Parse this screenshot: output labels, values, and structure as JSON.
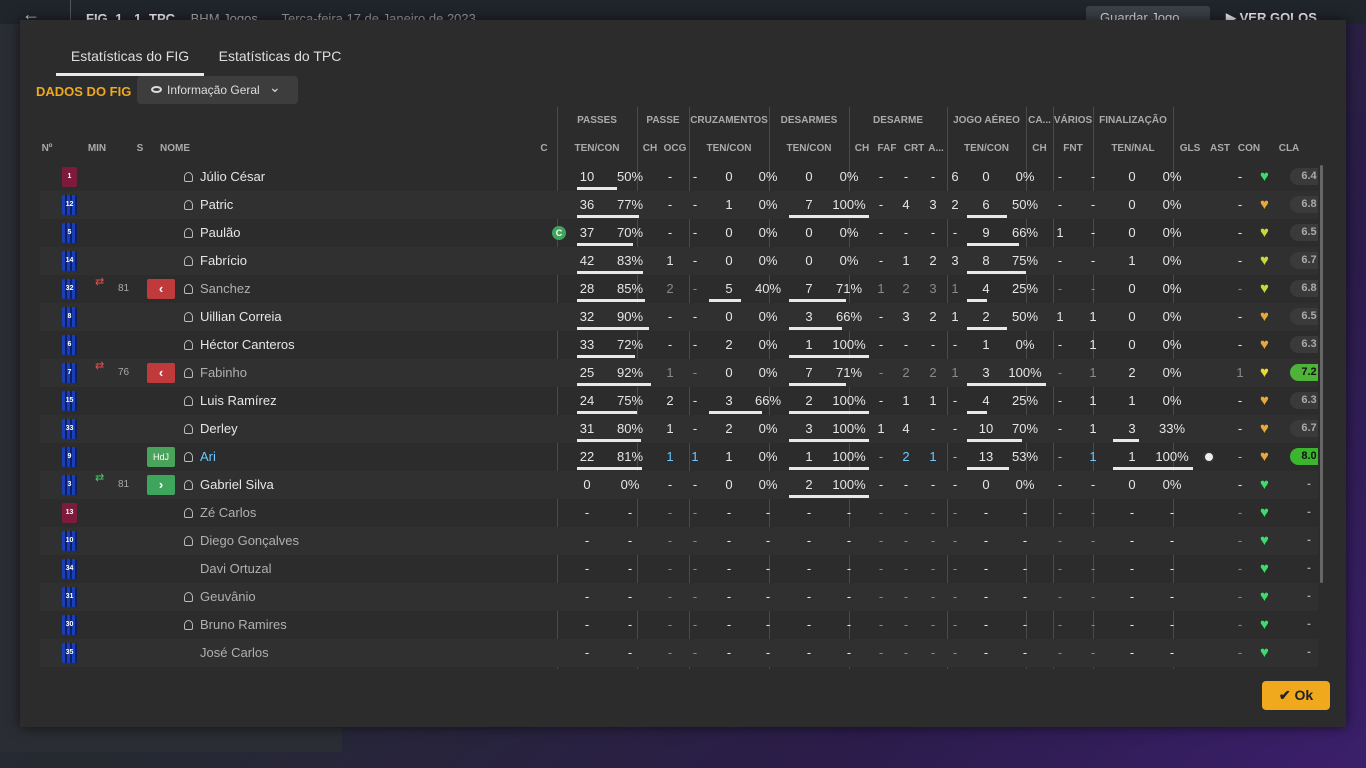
{
  "topbar": {
    "home": "FIG",
    "score_home": "1",
    "score_away": "1",
    "away": "TPC",
    "competition": "BHM Jogos",
    "date": "Terça-feira 17 de Janeiro de 2023",
    "save_label": "Guardar Jogo",
    "goals_label": "VER GOLOS"
  },
  "tabs": [
    "Estatísticas do FIG",
    "Estatísticas do TPC"
  ],
  "section_title": "DADOS DO FIG",
  "view_dropdown": "Informação Geral",
  "group_headers": {
    "passes": "PASSES",
    "passe": "PASSE",
    "cruzamentos": "CRUZAMENTOS",
    "desarmes": "DESARMES",
    "desarme": "DESARME",
    "jogo_aereo": "JOGO AÉREO",
    "ca": "CA...",
    "varios": "VÁRIOS",
    "finalizacao": "FINALIZAÇÃO"
  },
  "columns": {
    "no": "Nº",
    "min": "MIN",
    "s": "S",
    "nome": "NOME",
    "c": "C",
    "passes_tc": "TEN/CON",
    "passe_ch": "CH",
    "passe_ocg": "OCG",
    "cruz_tc": "TEN/CON",
    "des_tc": "TEN/CON",
    "desa_ch": "CH",
    "desa_faf": "FAF",
    "desa_crt": "CRT",
    "desa_a": "A...",
    "aereo_tc": "TEN/CON",
    "ca_ch": "CH",
    "var_fnt": "FNT",
    "fin_tn": "TEN/NAL",
    "gls": "GLS",
    "ast": "AST",
    "con": "CON",
    "cla": "CLA"
  },
  "players": [
    {
      "no": "1",
      "shirt": "gk",
      "min": "",
      "sub": "",
      "name": "Júlio César",
      "cap": false,
      "dim": false,
      "hl": false,
      "pas": "10",
      "pasp": "50%",
      "pch": "-",
      "ocg": "-",
      "cru": "0",
      "crup": "0%",
      "des": "0",
      "desp": "0%",
      "dch": "-",
      "faf": "-",
      "crt": "-",
      "da": "6",
      "aer": "0",
      "aerp": "0%",
      "cach": "-",
      "fnt": "-",
      "fin": "0",
      "finp": "0%",
      "gls": "",
      "ast": "-",
      "con": "#3ddc6a",
      "cla": "6.4",
      "rate": ""
    },
    {
      "no": "12",
      "shirt": "blue",
      "min": "",
      "sub": "",
      "name": "Patric",
      "cap": false,
      "dim": false,
      "hl": false,
      "pas": "36",
      "pasp": "77%",
      "pch": "-",
      "ocg": "-",
      "cru": "1",
      "crup": "0%",
      "des": "7",
      "desp": "100%",
      "dch": "-",
      "faf": "4",
      "crt": "3",
      "da": "2",
      "aer": "6",
      "aerp": "50%",
      "cach": "-",
      "fnt": "-",
      "fin": "0",
      "finp": "0%",
      "gls": "",
      "ast": "-",
      "con": "#e8a83a",
      "cla": "6.8",
      "rate": ""
    },
    {
      "no": "5",
      "shirt": "blue",
      "min": "",
      "sub": "",
      "name": "Paulão",
      "cap": true,
      "dim": false,
      "hl": false,
      "pas": "37",
      "pasp": "70%",
      "pch": "-",
      "ocg": "-",
      "cru": "0",
      "crup": "0%",
      "des": "0",
      "desp": "0%",
      "dch": "-",
      "faf": "-",
      "crt": "-",
      "da": "-",
      "aer": "9",
      "aerp": "66%",
      "cach": "1",
      "fnt": "-",
      "fin": "0",
      "finp": "0%",
      "gls": "",
      "ast": "-",
      "con": "#c8d83a",
      "cla": "6.5",
      "rate": ""
    },
    {
      "no": "14",
      "shirt": "blue",
      "min": "",
      "sub": "",
      "name": "Fabrício",
      "cap": false,
      "dim": false,
      "hl": false,
      "pas": "42",
      "pasp": "83%",
      "pch": "1",
      "ocg": "-",
      "cru": "0",
      "crup": "0%",
      "des": "0",
      "desp": "0%",
      "dch": "-",
      "faf": "1",
      "crt": "2",
      "da": "3",
      "aer": "8",
      "aerp": "75%",
      "cach": "-",
      "fnt": "-",
      "fin": "1",
      "finp": "0%",
      "gls": "",
      "ast": "-",
      "con": "#c8d83a",
      "cla": "6.7",
      "rate": ""
    },
    {
      "no": "32",
      "shirt": "blue",
      "min": "81",
      "sub": "out",
      "name": "Sanchez",
      "cap": false,
      "dim": true,
      "hl": false,
      "pas": "28",
      "pasp": "85%",
      "pch": "2",
      "ocg": "-",
      "cru": "5",
      "crup": "40%",
      "des": "7",
      "desp": "71%",
      "dch": "1",
      "faf": "2",
      "crt": "3",
      "da": "1",
      "aer": "4",
      "aerp": "25%",
      "cach": "-",
      "fnt": "-",
      "fin": "0",
      "finp": "0%",
      "gls": "",
      "ast": "-",
      "con": "#c8d83a",
      "cla": "6.8",
      "rate": ""
    },
    {
      "no": "8",
      "shirt": "blue",
      "min": "",
      "sub": "",
      "name": "Uillian Correia",
      "cap": false,
      "dim": false,
      "hl": false,
      "pas": "32",
      "pasp": "90%",
      "pch": "-",
      "ocg": "-",
      "cru": "0",
      "crup": "0%",
      "des": "3",
      "desp": "66%",
      "dch": "-",
      "faf": "3",
      "crt": "2",
      "da": "1",
      "aer": "2",
      "aerp": "50%",
      "cach": "1",
      "fnt": "1",
      "fin": "0",
      "finp": "0%",
      "gls": "",
      "ast": "-",
      "con": "#e8a83a",
      "cla": "6.5",
      "rate": ""
    },
    {
      "no": "6",
      "shirt": "blue",
      "min": "",
      "sub": "",
      "name": "Héctor Canteros",
      "cap": false,
      "dim": false,
      "hl": false,
      "pas": "33",
      "pasp": "72%",
      "pch": "-",
      "ocg": "-",
      "cru": "2",
      "crup": "0%",
      "des": "1",
      "desp": "100%",
      "dch": "-",
      "faf": "-",
      "crt": "-",
      "da": "-",
      "aer": "1",
      "aerp": "0%",
      "cach": "-",
      "fnt": "1",
      "fin": "0",
      "finp": "0%",
      "gls": "",
      "ast": "-",
      "con": "#e8a83a",
      "cla": "6.3",
      "rate": ""
    },
    {
      "no": "7",
      "shirt": "blue",
      "min": "76",
      "sub": "out",
      "name": "Fabinho",
      "cap": false,
      "dim": true,
      "hl": false,
      "pas": "25",
      "pasp": "92%",
      "pch": "1",
      "ocg": "-",
      "cru": "0",
      "crup": "0%",
      "des": "7",
      "desp": "71%",
      "dch": "-",
      "faf": "2",
      "crt": "2",
      "da": "1",
      "aer": "3",
      "aerp": "100%",
      "cach": "-",
      "fnt": "1",
      "fin": "2",
      "finp": "0%",
      "gls": "",
      "ast": "1",
      "con": "#e8d83a",
      "cla": "7.2",
      "rate": "good"
    },
    {
      "no": "15",
      "shirt": "blue",
      "min": "",
      "sub": "",
      "name": "Luis Ramírez",
      "cap": false,
      "dim": false,
      "hl": false,
      "pas": "24",
      "pasp": "75%",
      "pch": "2",
      "ocg": "-",
      "cru": "3",
      "crup": "66%",
      "des": "2",
      "desp": "100%",
      "dch": "-",
      "faf": "1",
      "crt": "1",
      "da": "-",
      "aer": "4",
      "aerp": "25%",
      "cach": "-",
      "fnt": "1",
      "fin": "1",
      "finp": "0%",
      "gls": "",
      "ast": "-",
      "con": "#e8a83a",
      "cla": "6.3",
      "rate": ""
    },
    {
      "no": "33",
      "shirt": "blue",
      "min": "",
      "sub": "",
      "name": "Derley",
      "cap": false,
      "dim": false,
      "hl": false,
      "pas": "31",
      "pasp": "80%",
      "pch": "1",
      "ocg": "-",
      "cru": "2",
      "crup": "0%",
      "des": "3",
      "desp": "100%",
      "dch": "1",
      "faf": "4",
      "crt": "-",
      "da": "-",
      "aer": "10",
      "aerp": "70%",
      "cach": "-",
      "fnt": "1",
      "fin": "3",
      "finp": "33%",
      "gls": "",
      "ast": "-",
      "con": "#e8a83a",
      "cla": "6.7",
      "rate": ""
    },
    {
      "no": "9",
      "shirt": "blue",
      "min": "",
      "sub": "hdl",
      "name": "Ari",
      "cap": false,
      "dim": false,
      "hl": true,
      "pas": "22",
      "pasp": "81%",
      "pch": "1",
      "ocg": "1",
      "cru": "1",
      "crup": "0%",
      "des": "1",
      "desp": "100%",
      "dch": "-",
      "faf": "2",
      "crt": "1",
      "da": "-",
      "aer": "13",
      "aerp": "53%",
      "cach": "-",
      "fnt": "1",
      "fin": "1",
      "finp": "100%",
      "gls": "ball",
      "ast": "-",
      "con": "#e8a83a",
      "cla": "8.0",
      "rate": "great"
    },
    {
      "no": "3",
      "shirt": "blue",
      "min": "81",
      "sub": "in",
      "name": "Gabriel Silva",
      "cap": false,
      "dim": false,
      "hl": false,
      "pas": "0",
      "pasp": "0%",
      "pch": "-",
      "ocg": "-",
      "cru": "0",
      "crup": "0%",
      "des": "2",
      "desp": "100%",
      "dch": "-",
      "faf": "-",
      "crt": "-",
      "da": "-",
      "aer": "0",
      "aerp": "0%",
      "cach": "-",
      "fnt": "-",
      "fin": "0",
      "finp": "0%",
      "gls": "",
      "ast": "-",
      "con": "#3ddc6a",
      "cla": "-",
      "rate": ""
    },
    {
      "no": "13",
      "shirt": "gk",
      "min": "",
      "sub": "",
      "name": "Zé Carlos",
      "cap": false,
      "dim": true,
      "hl": false,
      "pas": "-",
      "pasp": "-",
      "pch": "-",
      "ocg": "-",
      "cru": "-",
      "crup": "-",
      "des": "-",
      "desp": "-",
      "dch": "-",
      "faf": "-",
      "crt": "-",
      "da": "-",
      "aer": "-",
      "aerp": "-",
      "cach": "-",
      "fnt": "-",
      "fin": "-",
      "finp": "-",
      "gls": "",
      "ast": "-",
      "con": "#3ddc6a",
      "cla": "-",
      "rate": ""
    },
    {
      "no": "10",
      "shirt": "blue",
      "min": "",
      "sub": "",
      "name": "Diego Gonçalves",
      "cap": false,
      "dim": true,
      "hl": false,
      "pas": "-",
      "pasp": "-",
      "pch": "-",
      "ocg": "-",
      "cru": "-",
      "crup": "-",
      "des": "-",
      "desp": "-",
      "dch": "-",
      "faf": "-",
      "crt": "-",
      "da": "-",
      "aer": "-",
      "aerp": "-",
      "cach": "-",
      "fnt": "-",
      "fin": "-",
      "finp": "-",
      "gls": "",
      "ast": "-",
      "con": "#3ddc6a",
      "cla": "-",
      "rate": ""
    },
    {
      "no": "34",
      "shirt": "blue",
      "min": "",
      "sub": "",
      "name": "Davi Ortuzal",
      "nohead": true,
      "cap": false,
      "dim": true,
      "hl": false,
      "pas": "-",
      "pasp": "-",
      "pch": "-",
      "ocg": "-",
      "cru": "-",
      "crup": "-",
      "des": "-",
      "desp": "-",
      "dch": "-",
      "faf": "-",
      "crt": "-",
      "da": "-",
      "aer": "-",
      "aerp": "-",
      "cach": "-",
      "fnt": "-",
      "fin": "-",
      "finp": "-",
      "gls": "",
      "ast": "-",
      "con": "#3ddc6a",
      "cla": "-",
      "rate": ""
    },
    {
      "no": "31",
      "shirt": "blue",
      "min": "",
      "sub": "",
      "name": "Geuvânio",
      "cap": false,
      "dim": true,
      "hl": false,
      "pas": "-",
      "pasp": "-",
      "pch": "-",
      "ocg": "-",
      "cru": "-",
      "crup": "-",
      "des": "-",
      "desp": "-",
      "dch": "-",
      "faf": "-",
      "crt": "-",
      "da": "-",
      "aer": "-",
      "aerp": "-",
      "cach": "-",
      "fnt": "-",
      "fin": "-",
      "finp": "-",
      "gls": "",
      "ast": "-",
      "con": "#3ddc6a",
      "cla": "-",
      "rate": ""
    },
    {
      "no": "30",
      "shirt": "blue",
      "min": "",
      "sub": "",
      "name": "Bruno Ramires",
      "cap": false,
      "dim": true,
      "hl": false,
      "pas": "-",
      "pasp": "-",
      "pch": "-",
      "ocg": "-",
      "cru": "-",
      "crup": "-",
      "des": "-",
      "desp": "-",
      "dch": "-",
      "faf": "-",
      "crt": "-",
      "da": "-",
      "aer": "-",
      "aerp": "-",
      "cach": "-",
      "fnt": "-",
      "fin": "-",
      "finp": "-",
      "gls": "",
      "ast": "-",
      "con": "#3ddc6a",
      "cla": "-",
      "rate": ""
    },
    {
      "no": "35",
      "shirt": "blue",
      "min": "",
      "sub": "",
      "name": "José Carlos",
      "nohead": true,
      "cap": false,
      "dim": true,
      "hl": false,
      "pas": "-",
      "pasp": "-",
      "pch": "-",
      "ocg": "-",
      "cru": "-",
      "crup": "-",
      "des": "-",
      "desp": "-",
      "dch": "-",
      "faf": "-",
      "crt": "-",
      "da": "-",
      "aer": "-",
      "aerp": "-",
      "cach": "-",
      "fnt": "-",
      "fin": "-",
      "finp": "-",
      "gls": "",
      "ast": "-",
      "con": "#3ddc6a",
      "cla": "-",
      "rate": ""
    }
  ],
  "ok_label": "Ok"
}
